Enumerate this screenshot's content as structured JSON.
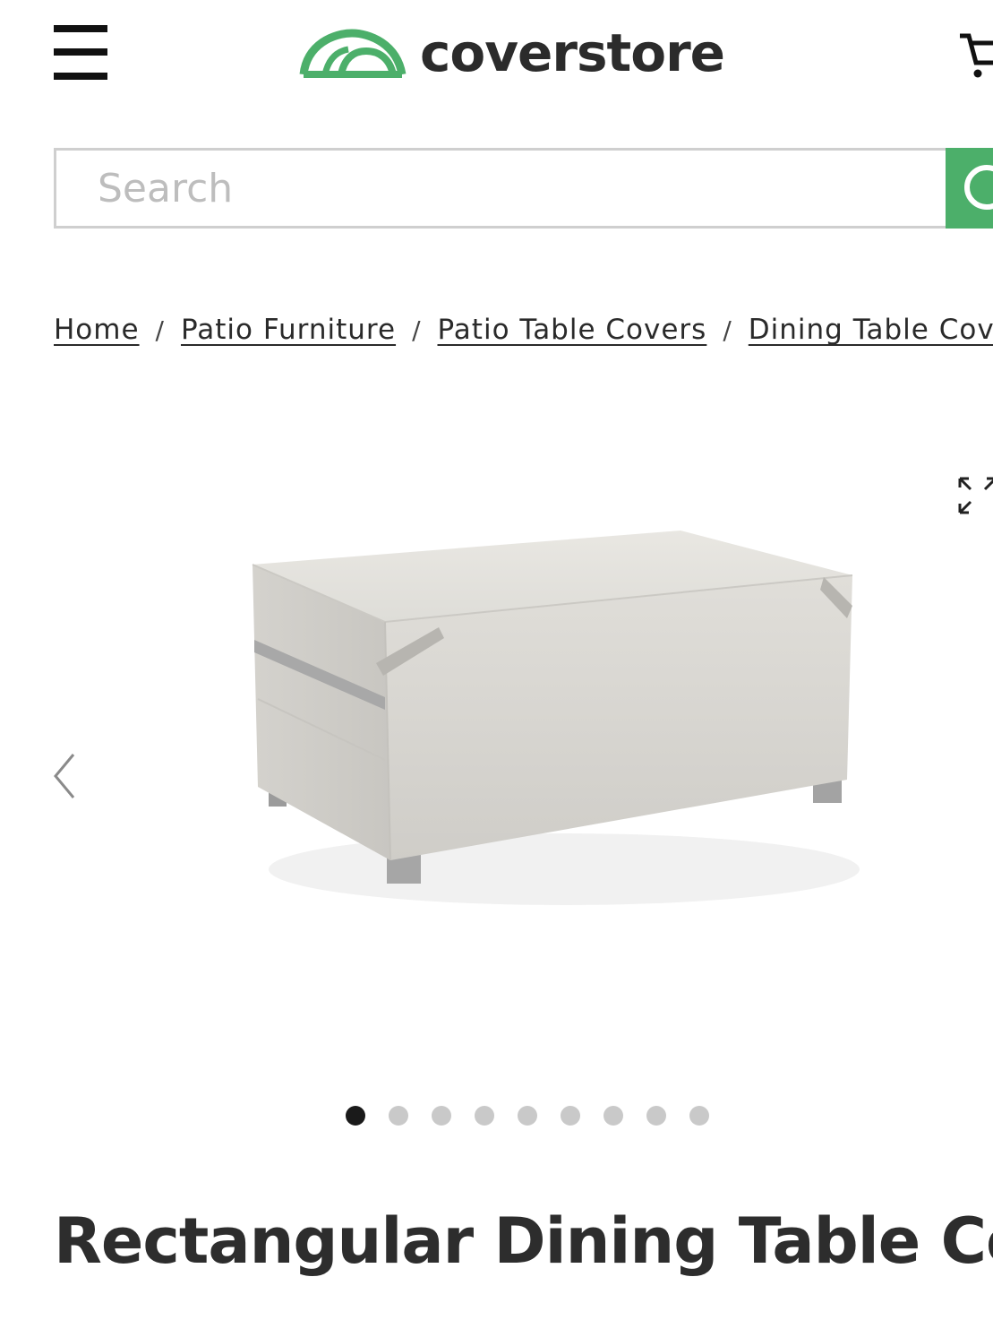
{
  "header": {
    "logo_text": "coverstore",
    "brand_color": "#4caf6a",
    "menu_icon": "hamburger-icon",
    "cart_icon": "cart-icon"
  },
  "search": {
    "placeholder": "Search",
    "value": "",
    "button_icon": "search-icon"
  },
  "breadcrumb": [
    {
      "label": "Home"
    },
    {
      "label": "Patio Furniture"
    },
    {
      "label": "Patio Table Covers"
    },
    {
      "label": "Dining Table Covers"
    }
  ],
  "breadcrumb_separator": "/",
  "gallery": {
    "expand_icon": "expand-icon",
    "prev_icon": "chevron-left-icon",
    "image_alt": "Rectangular Dining Table Cover",
    "slide_count": 9,
    "active_slide": 1
  },
  "product": {
    "title": "Rectangular Dining Table Cover"
  }
}
